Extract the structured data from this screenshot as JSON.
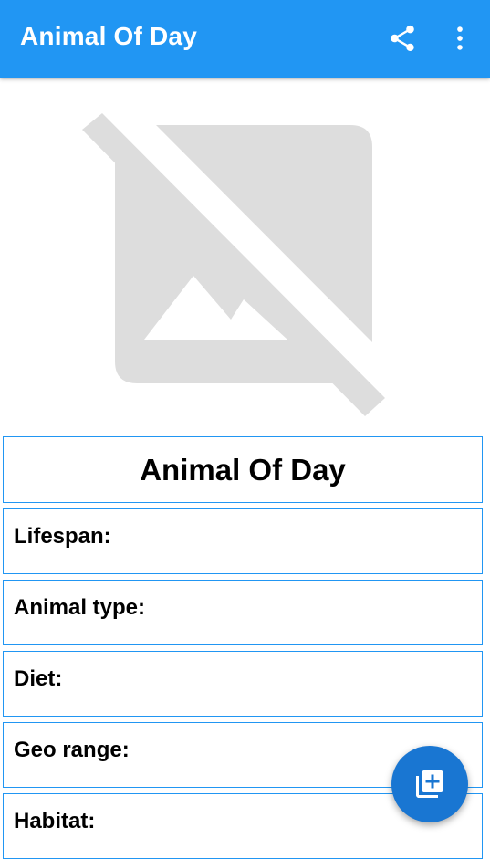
{
  "appbar": {
    "title": "Animal Of Day",
    "share_icon": "share-icon",
    "more_icon": "more-vert-icon",
    "color": "#2196F3"
  },
  "image": {
    "icon": "broken-image-icon"
  },
  "card": {
    "title": "Animal Of Day",
    "border_color": "#2196F3"
  },
  "fields": {
    "lifespan": "Lifespan:",
    "animal_type": "Animal type:",
    "diet": "Diet:",
    "geo_range": "Geo range:",
    "habitat": "Habitat:"
  },
  "fab": {
    "icon": "add-to-library-icon",
    "color": "#1976D2"
  }
}
